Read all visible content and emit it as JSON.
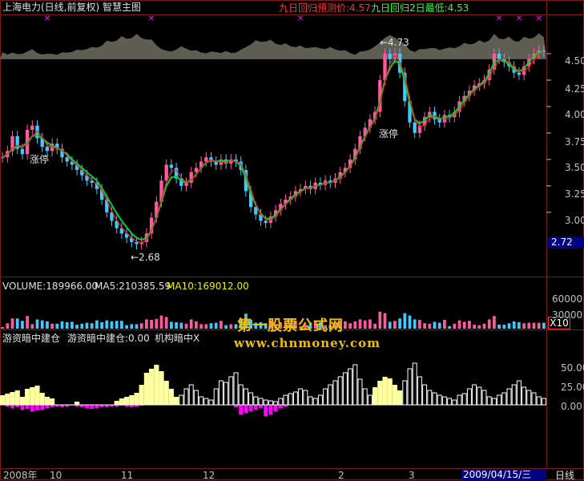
{
  "title": "上海电力(日线,前复权) 智慧主图",
  "forecast_label": "九日回归预测价:4.57",
  "forecast_low_label": "九日回归2日最低:4.53",
  "volume_header": {
    "volume": "VOLUME:189966.00",
    "ma5": "MA5:210385.59",
    "ma10": "MA10:169012.00"
  },
  "indicator_header": {
    "label1": "游资暗中建仓",
    "label2": "游资暗中建仓:0.00",
    "label3": "机构暗中X"
  },
  "watermark": {
    "line1": "第一股票公式网",
    "line2": "www.chnmoney.com"
  },
  "annotations": {
    "limit_up_1": "涨停",
    "limit_up_2": "涨停",
    "low_marker": "←2.68",
    "high_marker": "←4.73"
  },
  "price_axis": [
    "4.50",
    "4.25",
    "4.00",
    "3.75",
    "3.50",
    "3.25",
    "3.00"
  ],
  "current_price": "2.72",
  "volume_axis": [
    "60000",
    "30000"
  ],
  "volume_unit": "X10",
  "indicator_axis": [
    "50.00",
    "25.00",
    "0.00"
  ],
  "x_axis": {
    "labels": [
      "2008年",
      "10",
      "11",
      "12",
      "2",
      "3"
    ],
    "date_cursor": "2009/04/15/三",
    "period": "日线"
  },
  "colors": {
    "background": "#000000",
    "up": "#ff5aa0",
    "down": "#40c8ff",
    "ma": "#00d040",
    "ma_fast": "#ff2020",
    "grid": "#7a1a1a",
    "band": "#6e6e60",
    "indicator_yellow": "#ffffa0",
    "indicator_magenta": "#ff00ff",
    "title_red": "#ff3030",
    "title_green": "#30ff30",
    "axis_text": "#c0c0c0",
    "watermark": "#f0c000",
    "cursor_box": "#000080"
  },
  "chart_data": {
    "type": "candlestick",
    "price_range": [
      2.62,
      4.78
    ],
    "closes": [
      3.52,
      3.58,
      3.72,
      3.6,
      3.55,
      3.78,
      3.82,
      3.7,
      3.62,
      3.58,
      3.65,
      3.6,
      3.52,
      3.48,
      3.45,
      3.4,
      3.35,
      3.3,
      3.28,
      3.22,
      3.12,
      3.0,
      2.92,
      2.85,
      2.8,
      2.76,
      2.72,
      2.7,
      2.72,
      2.8,
      2.95,
      3.1,
      3.3,
      3.45,
      3.42,
      3.32,
      3.25,
      3.28,
      3.38,
      3.42,
      3.48,
      3.52,
      3.48,
      3.45,
      3.5,
      3.46,
      3.5,
      3.48,
      3.4,
      3.2,
      3.05,
      2.98,
      2.92,
      2.9,
      2.96,
      3.02,
      3.08,
      3.12,
      3.15,
      3.2,
      3.22,
      3.25,
      3.22,
      3.28,
      3.26,
      3.3,
      3.28,
      3.32,
      3.38,
      3.42,
      3.5,
      3.6,
      3.72,
      3.8,
      3.88,
      3.95,
      4.25,
      4.5,
      4.45,
      4.5,
      4.32,
      4.05,
      3.85,
      3.75,
      3.82,
      3.9,
      3.95,
      3.88,
      3.85,
      3.92,
      3.9,
      3.95,
      4.05,
      4.1,
      4.15,
      4.2,
      4.22,
      4.25,
      4.35,
      4.5,
      4.45,
      4.42,
      4.38,
      4.32,
      4.3,
      4.38,
      4.45,
      4.5,
      4.53,
      4.52
    ],
    "volume_ma": [
      3.52,
      3.55,
      3.6,
      3.62,
      3.62,
      3.66,
      3.72,
      3.73,
      3.7,
      3.66,
      3.63,
      3.61,
      3.58,
      3.55,
      3.5,
      3.46,
      3.42,
      3.38,
      3.34,
      3.3,
      3.23,
      3.15,
      3.07,
      2.99,
      2.92,
      2.86,
      2.8,
      2.76,
      2.74,
      2.76,
      2.83,
      2.95,
      3.1,
      3.25,
      3.33,
      3.34,
      3.3,
      3.28,
      3.31,
      3.36,
      3.42,
      3.47,
      3.49,
      3.48,
      3.49,
      3.48,
      3.49,
      3.48,
      3.44,
      3.32,
      3.18,
      3.07,
      2.99,
      2.94,
      2.94,
      2.98,
      3.03,
      3.08,
      3.13,
      3.17,
      3.2,
      3.23,
      3.23,
      3.25,
      3.26,
      3.28,
      3.28,
      3.3,
      3.34,
      3.38,
      3.44,
      3.52,
      3.62,
      3.72,
      3.81,
      3.89,
      4.05,
      4.25,
      4.36,
      4.44,
      4.4,
      4.24,
      4.04,
      3.88,
      3.84,
      3.87,
      3.92,
      3.9,
      3.88,
      3.9,
      3.91,
      3.94,
      4.0,
      4.06,
      4.12,
      4.17,
      4.2,
      4.24,
      4.31,
      4.42,
      4.44,
      4.43,
      4.4,
      4.35,
      4.33,
      4.36,
      4.42,
      4.48,
      4.51,
      4.52
    ],
    "indicator_yellow": [
      12,
      14,
      16,
      18,
      10,
      20,
      22,
      24,
      15,
      10,
      8,
      0,
      0,
      0,
      0,
      4,
      0,
      0,
      0,
      0,
      0,
      0,
      0,
      5,
      8,
      10,
      12,
      15,
      25,
      40,
      45,
      50,
      42,
      30,
      20,
      10,
      0,
      0,
      0,
      0,
      0,
      0,
      0,
      0,
      0,
      0,
      0,
      0,
      0,
      0,
      0,
      0,
      0,
      0,
      0,
      0,
      0,
      0,
      0,
      0,
      0,
      0,
      0,
      0,
      0,
      0,
      0,
      0,
      0,
      0,
      0,
      0,
      0,
      0,
      0,
      22,
      30,
      35,
      33,
      25,
      18,
      0,
      0,
      0,
      0,
      0,
      0,
      0,
      0,
      0,
      0,
      0,
      0,
      0,
      0,
      0,
      0,
      0,
      0,
      0,
      0,
      0,
      0,
      0,
      0,
      0,
      0,
      0,
      0,
      0
    ],
    "indicator_white": [
      0,
      0,
      0,
      0,
      0,
      0,
      0,
      0,
      0,
      0,
      0,
      0,
      0,
      0,
      0,
      0,
      0,
      0,
      0,
      0,
      0,
      0,
      0,
      0,
      0,
      0,
      0,
      0,
      0,
      0,
      0,
      0,
      0,
      0,
      0,
      0,
      12,
      20,
      25,
      18,
      10,
      8,
      6,
      20,
      30,
      28,
      35,
      40,
      25,
      20,
      15,
      10,
      8,
      6,
      5,
      4,
      8,
      12,
      14,
      16,
      20,
      18,
      10,
      8,
      12,
      20,
      25,
      30,
      35,
      40,
      45,
      50,
      32,
      20,
      12,
      0,
      0,
      0,
      0,
      0,
      0,
      30,
      45,
      52,
      35,
      25,
      18,
      15,
      12,
      10,
      8,
      6,
      12,
      14,
      20,
      25,
      22,
      18,
      10,
      8,
      12,
      15,
      20,
      25,
      30,
      22,
      18,
      15,
      10,
      8
    ],
    "indicator_magenta": [
      0,
      -2,
      -4,
      -3,
      -6,
      -5,
      -8,
      -7,
      -6,
      -4,
      -3,
      -2,
      -3,
      -2,
      -1,
      -2,
      -3,
      -4,
      -5,
      -4,
      -3,
      -3,
      -2,
      -2,
      -1,
      -2,
      -3,
      -2,
      -1,
      0,
      0,
      0,
      0,
      0,
      0,
      0,
      0,
      0,
      0,
      0,
      0,
      0,
      0,
      0,
      0,
      0,
      0,
      -3,
      -12,
      -10,
      -8,
      -6,
      -4,
      -14,
      -12,
      -8,
      -4,
      -2,
      0,
      0,
      0,
      0,
      0,
      0,
      0,
      0,
      0,
      0,
      0,
      0,
      0,
      0,
      0,
      0,
      0,
      0,
      0,
      0,
      0,
      0,
      0,
      0,
      0,
      0,
      0,
      0,
      0,
      0,
      0,
      0,
      0,
      0,
      0,
      0,
      0,
      0,
      0,
      0,
      0,
      0,
      0,
      0,
      0,
      0,
      0,
      0,
      0,
      0,
      0,
      0
    ]
  }
}
